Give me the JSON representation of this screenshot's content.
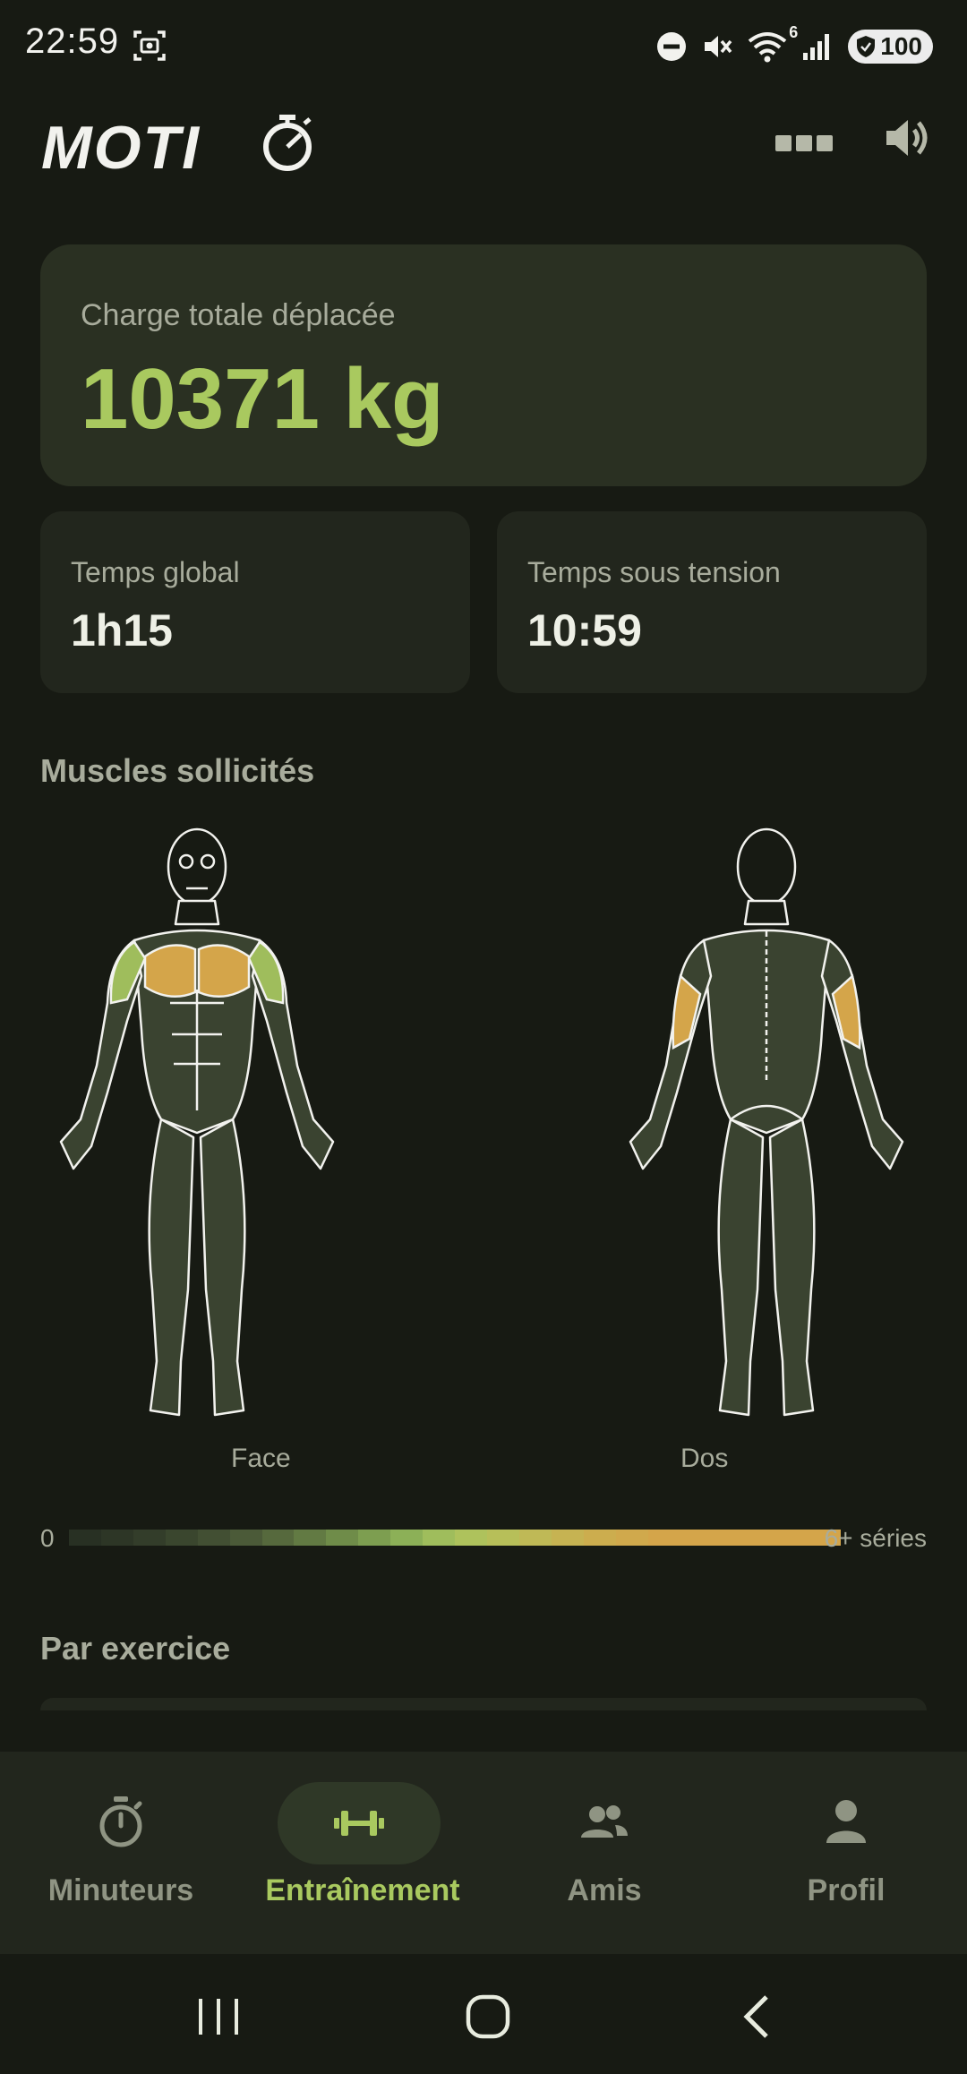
{
  "status_bar": {
    "time": "22:59",
    "battery": "100",
    "wifi_badge": "6",
    "icons": [
      "screenshot-icon",
      "do-not-disturb-icon",
      "mute-icon",
      "wifi-icon",
      "signal-icon",
      "battery-icon"
    ]
  },
  "header": {
    "logo_text": "MOTIO",
    "actions": [
      "grid-icon",
      "volume-icon"
    ]
  },
  "stats": {
    "total_load_label": "Charge totale déplacée",
    "total_load_value": "10371 kg",
    "global_time_label": "Temps global",
    "global_time_value": "1h15",
    "tension_time_label": "Temps sous tension",
    "tension_time_value": "10:59"
  },
  "muscles": {
    "section_title": "Muscles sollicités",
    "front_caption": "Face",
    "back_caption": "Dos",
    "legend_min": "0",
    "legend_max": "6+ séries",
    "highlighted_front": [
      "chest",
      "front-deltoids"
    ],
    "highlighted_back": [
      "triceps"
    ]
  },
  "exercises": {
    "section_title": "Par exercice"
  },
  "bottom_nav": {
    "items": [
      {
        "label": "Minuteurs",
        "icon": "stopwatch-icon"
      },
      {
        "label": "Entraînement",
        "icon": "dumbbell-icon",
        "active": true
      },
      {
        "label": "Amis",
        "icon": "friends-icon"
      },
      {
        "label": "Profil",
        "icon": "person-icon"
      }
    ]
  },
  "colors": {
    "accent": "#a9c95f",
    "background": "#171a13",
    "card": "#22261d",
    "card_highlight": "#2a3022",
    "muscle_high": "#d4a54a",
    "muscle_mid": "#9fbd5c",
    "muscle_base": "#3a4330"
  }
}
